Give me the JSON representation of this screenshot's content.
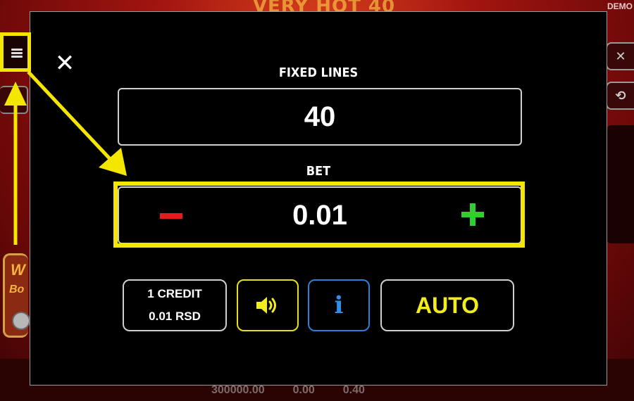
{
  "background": {
    "title": "VERY HOT 40",
    "demo_label": "DEMO",
    "left_card_line1": "W",
    "left_card_line2": "Bo",
    "bottom_values": [
      "300000.00",
      "0.00",
      "0.40"
    ]
  },
  "modal": {
    "close_icon": "close-icon",
    "fixed_lines_label": "FIXED LINES",
    "fixed_lines_value": "40",
    "bet_label": "BET",
    "bet_value": "0.01",
    "credit_line1": "1 CREDIT",
    "credit_line2": "0.01 RSD",
    "sound_icon": "speaker-icon",
    "info_icon": "info-icon",
    "info_glyph": "i",
    "auto_label": "AUTO"
  },
  "highlight": {
    "color": "#f5e600",
    "menu_icon": "hamburger-menu-icon"
  },
  "colors": {
    "minus": "#e31b1b",
    "plus": "#2fcf2f",
    "auto_text": "#f2ec1c",
    "sound_border": "#e6e01a",
    "info_border": "#2f7fd8"
  }
}
